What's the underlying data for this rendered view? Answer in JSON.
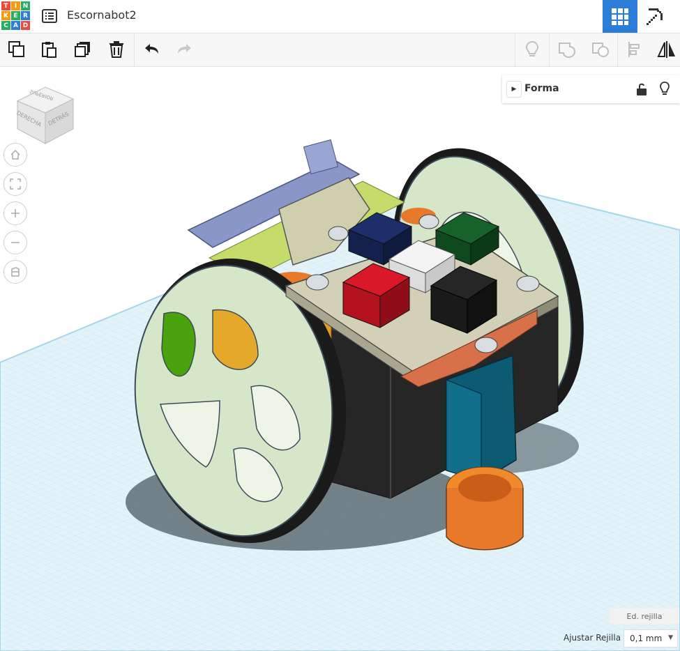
{
  "app": {
    "logo_letters": [
      "T",
      "I",
      "N",
      "K",
      "E",
      "R",
      "C",
      "A",
      "D"
    ],
    "logo_colors": [
      "#e74c3c",
      "#f39c12",
      "#27ae60",
      "#f39c12",
      "#27ae60",
      "#2b7dd8",
      "#27ae60",
      "#2b7dd8",
      "#e74c3c"
    ],
    "project_title": "Escornabot2"
  },
  "header": {
    "menu_icon": "list-icon",
    "views": [
      {
        "name": "3d-design-view",
        "icon": "grid-icon",
        "active": true
      },
      {
        "name": "minecraft-view",
        "icon": "pickaxe-icon",
        "active": false
      }
    ]
  },
  "toolbar": {
    "left": [
      {
        "name": "copy-button",
        "icon": "copy-icon"
      },
      {
        "name": "paste-button",
        "icon": "paste-icon"
      },
      {
        "name": "duplicate-button",
        "icon": "duplicate-icon"
      },
      {
        "name": "delete-button",
        "icon": "trash-icon"
      },
      {
        "name": "undo-button",
        "icon": "undo-icon"
      },
      {
        "name": "redo-button",
        "icon": "redo-icon"
      }
    ],
    "right": [
      {
        "name": "hint-button",
        "icon": "bulb-icon"
      },
      {
        "name": "group-button",
        "icon": "group-icon"
      },
      {
        "name": "ungroup-button",
        "icon": "ungroup-icon"
      },
      {
        "name": "align-button",
        "icon": "align-icon"
      },
      {
        "name": "mirror-button",
        "icon": "mirror-icon"
      }
    ]
  },
  "viewcube": {
    "faces": [
      "SUPERIOR",
      "DERECHA",
      "DETRÁS"
    ]
  },
  "nav": [
    {
      "name": "home-view-button",
      "icon": "home-icon"
    },
    {
      "name": "fit-view-button",
      "icon": "fit-icon"
    },
    {
      "name": "zoom-in-button",
      "icon": "plus-icon"
    },
    {
      "name": "zoom-out-button",
      "icon": "minus-icon"
    },
    {
      "name": "ortho-view-button",
      "icon": "perspective-icon"
    }
  ],
  "shape_panel": {
    "label": "Forma",
    "lock_icon": "unlock-icon",
    "light_icon": "bulb-icon"
  },
  "grid": {
    "edit_label": "Ed. rejilla",
    "snap_label": "Ajustar Rejilla",
    "snap_value": "0,1 mm"
  },
  "colors": {
    "accent": "#2b7dd8",
    "workplane_line": "#9fd3e6",
    "workplane_bg": "#d6eef7"
  }
}
